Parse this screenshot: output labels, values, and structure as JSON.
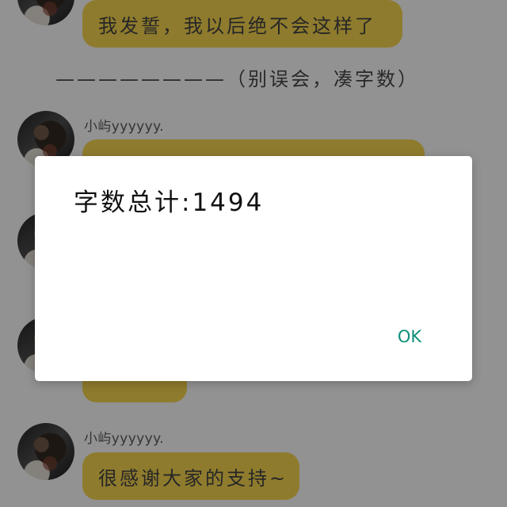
{
  "messages": {
    "top": "我发誓，我以后绝不会这样了",
    "note": "————————（别误会，凑字数）",
    "sender": "小屿yyyyyy.",
    "last_sender": "小屿yyyyyy.",
    "last": "很感谢大家的支持~"
  },
  "dialog": {
    "title": "字数总计:1494",
    "ok_label": "OK"
  }
}
